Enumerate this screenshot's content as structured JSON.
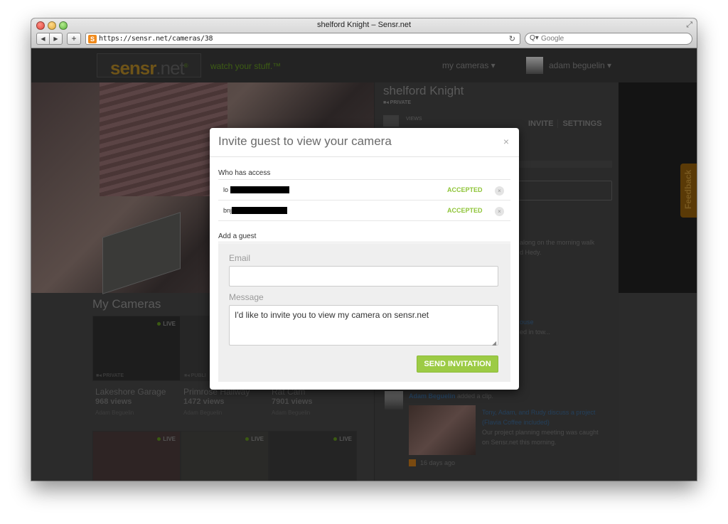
{
  "browser": {
    "window_title": "shelford Knight – Sensr.net",
    "url": "https://sensr.net/cameras/38",
    "search_placeholder": "Google",
    "back_glyph": "◀",
    "forward_glyph": "▶",
    "plus_glyph": "+",
    "reload_glyph": "↻",
    "search_glyph": "Q▾"
  },
  "site": {
    "logo_bold": "sensr",
    "logo_rest": ".net",
    "logo_mark": "®",
    "tagline": "watch your stuff.™",
    "nav_cameras": "my cameras  ▾",
    "nav_user": "adam beguelin  ▾",
    "feedback": "Feedback"
  },
  "camera_panel": {
    "title": "shelford Knight",
    "privacy": "■◂ PRIVATE",
    "views_label": "VIEWS",
    "tabs": [
      "INVITE",
      "SETTINGS"
    ],
    "feed": [
      {
        "text_a": "along on the morning walk",
        "text_b": "d Hedy."
      },
      {
        "text_a": "ouse",
        "text_b": "ed in tow..."
      },
      {
        "user": "Adam Beguelin",
        "action": " added a clip.",
        "clip_title_1": "Tony, Adam, and Rudy discuss a project",
        "clip_title_2": "(Flavia Coffee included)",
        "clip_desc_1": "Our project planning meeting was caught",
        "clip_desc_2": "on Sensr.net this morning.",
        "time": "16 days ago"
      }
    ]
  },
  "my_cameras": {
    "title": "My Cameras",
    "cameras": [
      {
        "name": "Lakeshore Garage",
        "views": "968 views",
        "owner": "Adam Beguelin",
        "live": "LIVE",
        "privacy": "■◂ PRIVATE"
      },
      {
        "name": "Primrose Hallway",
        "views": "1472 views",
        "owner": "Adam Beguelin",
        "live": "",
        "privacy": "■◂ PUBLI"
      },
      {
        "name": "Rat Cam",
        "views": "7901 views",
        "owner": "Adam Beguelin",
        "live": "",
        "privacy": ""
      }
    ],
    "second_row_live": [
      "LIVE",
      "LIVE",
      "LIVE"
    ]
  },
  "modal": {
    "title": "Invite guest to view your camera",
    "close_glyph": "×",
    "access_heading": "Who has access",
    "access": [
      {
        "email_prefix": "lo",
        "status": "ACCEPTED",
        "remove_glyph": "×"
      },
      {
        "email_prefix": "bnj",
        "status": "ACCEPTED",
        "remove_glyph": "×"
      }
    ],
    "add_heading": "Add a guest",
    "email_label": "Email",
    "email_value": "",
    "message_label": "Message",
    "message_value": "I'd like to invite you to view my camera on sensr.net",
    "send_label": "SEND INVITATION",
    "resize_glyph": "◢"
  },
  "colors": {
    "accent_green": "#9ccb45",
    "accepted_green": "#8ec437",
    "overlay_dark": "#2b2b2b"
  },
  "icons": [
    "back-icon",
    "forward-icon",
    "reload-icon",
    "search-icon",
    "close-icon",
    "remove-icon",
    "camera-icon"
  ]
}
